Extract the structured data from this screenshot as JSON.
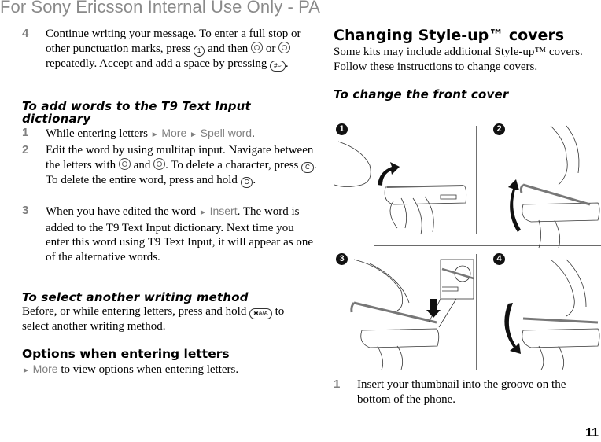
{
  "watermark": "For Sony Ericsson Internal Use Only - PA",
  "page_number": "11",
  "left": {
    "step4": {
      "num": "4",
      "t1": "Continue writing your message. To enter a full stop or other punctuation marks, press ",
      "key1": "1",
      "t2": " and then ",
      "t3": " or ",
      "t4": " repeatedly. Accept and add a space by pressing ",
      "key_hash": "#⌣",
      "t5": "."
    },
    "t9_heading": "To add words to the T9 Text Input dictionary",
    "t9_steps": [
      {
        "num": "1",
        "t1": "While entering letters ",
        "arrow": "►",
        "m1": "More",
        "m2": "Spell word",
        "end": "."
      },
      {
        "num": "2",
        "t1": "Edit the word by using multitap input. Navigate between the letters with ",
        "t2": " and ",
        "t3": ". To delete a character, press ",
        "key_c": "C",
        "t4": ". To delete the entire word, press and hold ",
        "t5": "."
      },
      {
        "num": "3",
        "t1": "When you have edited the word ",
        "arrow": "►",
        "m1": "Insert",
        "t2": ". The word is added to the T9 Text Input dictionary. Next time you enter this word using T9 Text Input, it will appear as one of the alternative words."
      }
    ],
    "method_heading": "To select another writing method",
    "method_t1": "Before, or while entering letters, press and hold ",
    "method_key": "✱a/A",
    "method_t2": " to select another writing method.",
    "options_heading": "Options when entering letters",
    "options_arrow": "►",
    "options_menu": "More",
    "options_text": " to view options when entering letters."
  },
  "right": {
    "heading": "Changing Style-up™ covers",
    "intro": "Some kits may include additional Style-up™ covers. Follow these instructions to change covers.",
    "subheading": "To change the front cover",
    "figure_badges": [
      "1",
      "2",
      "3",
      "4"
    ],
    "step1": {
      "num": "1",
      "text": "Insert your thumbnail into the groove on the bottom of the phone."
    }
  }
}
